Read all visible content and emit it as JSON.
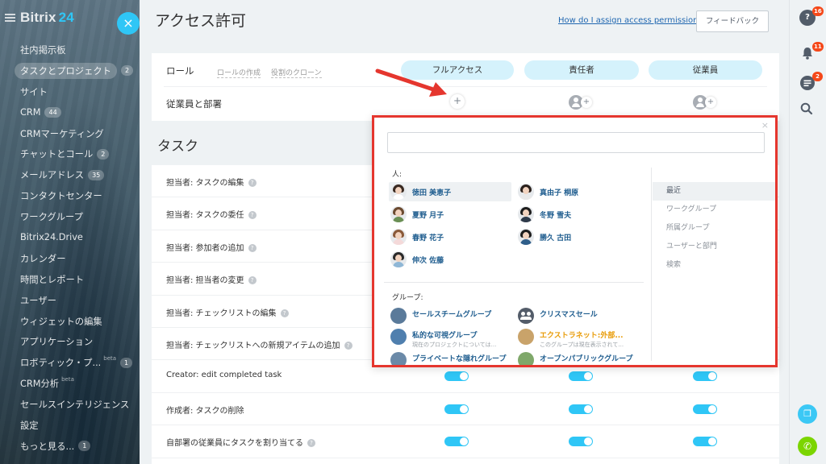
{
  "sidebar": {
    "brand": "Bitrix",
    "brand_suffix": "24",
    "close_icon": "×",
    "items": [
      {
        "label": "社内掲示板",
        "counter": "",
        "beta": ""
      },
      {
        "label": "タスクとプロジェクト",
        "counter": "2",
        "beta": "",
        "active": true
      },
      {
        "label": "サイト",
        "counter": "",
        "beta": ""
      },
      {
        "label": "CRM",
        "counter": "44",
        "beta": ""
      },
      {
        "label": "CRMマーケティング",
        "counter": "",
        "beta": ""
      },
      {
        "label": "チャットとコール",
        "counter": "2",
        "beta": ""
      },
      {
        "label": "メールアドレス",
        "counter": "35",
        "beta": ""
      },
      {
        "label": "コンタクトセンター",
        "counter": "",
        "beta": ""
      },
      {
        "label": "ワークグループ",
        "counter": "",
        "beta": ""
      },
      {
        "label": "Bitrix24.Drive",
        "counter": "",
        "beta": ""
      },
      {
        "label": "カレンダー",
        "counter": "",
        "beta": ""
      },
      {
        "label": "時間とレポート",
        "counter": "",
        "beta": ""
      },
      {
        "label": "ユーザー",
        "counter": "",
        "beta": ""
      },
      {
        "label": "ウィジェットの編集",
        "counter": "",
        "beta": ""
      },
      {
        "label": "アプリケーション",
        "counter": "",
        "beta": ""
      },
      {
        "label": "ロボティック・プ...",
        "counter": "1",
        "beta": "beta"
      },
      {
        "label": "CRM分析",
        "counter": "",
        "beta": "beta"
      },
      {
        "label": "セールスインテリジェンス",
        "counter": "",
        "beta": ""
      },
      {
        "label": "設定",
        "counter": "",
        "beta": ""
      },
      {
        "label": "もっと見る...",
        "counter": "1",
        "beta": ""
      }
    ]
  },
  "header": {
    "title": "アクセス許可",
    "help_link": "How do I assign access permissions?",
    "feedback_label": "フィードバック"
  },
  "roles": {
    "label": "ロール",
    "create_link": "ロールの作成",
    "clone_link": "役割のクローン",
    "pills": [
      "フルアクセス",
      "責任者",
      "従業員"
    ],
    "employees_label": "従業員と部署",
    "add_icon": "+"
  },
  "tasks": {
    "title": "タスク",
    "rows": [
      {
        "label": "担当者: タスクの編集",
        "help": true,
        "toggles": false
      },
      {
        "label": "担当者: タスクの委任",
        "help": true,
        "toggles": false
      },
      {
        "label": "担当者: 参加者の追加",
        "help": true,
        "toggles": false
      },
      {
        "label": "担当者: 担当者の変更",
        "help": true,
        "toggles": false
      },
      {
        "label": "担当者: チェックリストの編集",
        "help": true,
        "toggles": false
      },
      {
        "label": "担当者: チェックリストへの新規アイテムの追加",
        "help": true,
        "toggles": false
      },
      {
        "label": "Creator: edit completed task",
        "help": false,
        "toggles": true
      },
      {
        "label": "作成者: タスクの削除",
        "help": false,
        "toggles": true
      },
      {
        "label": "自部署の従業員にタスクを割り当てる",
        "help": true,
        "toggles": true
      }
    ],
    "help_icon": "?"
  },
  "popup": {
    "close_icon": "×",
    "search_placeholder": "",
    "people_label": "人:",
    "people": [
      {
        "name": "徳田 美恵子",
        "hair": "#3a2a22",
        "body": "#ffffff"
      },
      {
        "name": "真由子 桐原",
        "hair": "#2b211c",
        "body": "#e9e9e9"
      },
      {
        "name": "夏野 月子",
        "hair": "#6b4a30",
        "body": "#6a8f54"
      },
      {
        "name": "冬野 雪夫",
        "hair": "#1d1d1d",
        "body": "#2f3b4a"
      },
      {
        "name": "春野 花子",
        "hair": "#8a5a3a",
        "body": "#f4d9d9"
      },
      {
        "name": "勝久 古田",
        "hair": "#1d1d1d",
        "body": "#2f5e8a"
      },
      {
        "name": "伸次 佐藤",
        "hair": "#2a2a2a",
        "body": "#8fb7d6"
      }
    ],
    "groups_label": "グループ:",
    "groups": [
      {
        "name": "セールスチームグループ",
        "desc": "",
        "ext": false,
        "icon": "#5a7a9a"
      },
      {
        "name": "クリスマスセール",
        "desc": "",
        "ext": false,
        "icon": "people"
      },
      {
        "name": "私的な可視グループ",
        "desc": "現在のプロジェクトについては...",
        "ext": false,
        "icon": "#4f7fae"
      },
      {
        "name": "エクストラネット:外部...",
        "desc": "このグループは現在表示されて...",
        "ext": true,
        "icon": "#c9a36a"
      },
      {
        "name": "プライベートな隠れグループ",
        "desc": "",
        "ext": false,
        "icon": "#6b8aa8"
      },
      {
        "name": "オープンパブリックグループ",
        "desc": "",
        "ext": false,
        "icon": "#7fa86a"
      }
    ],
    "tabs": [
      "最近",
      "ワークグループ",
      "所属グループ",
      "ユーザーと部門",
      "検索"
    ]
  },
  "rightbar": {
    "help_icon": "?",
    "help_badge": "16",
    "bell_badge": "11",
    "chat_badge": "2",
    "search_icon": "⌕",
    "copy_icon": "❐",
    "phone_icon": "✆"
  },
  "colors": {
    "accent": "#2fc6f6",
    "highlight_border": "#e5362e",
    "link": "#1f5d8f"
  }
}
